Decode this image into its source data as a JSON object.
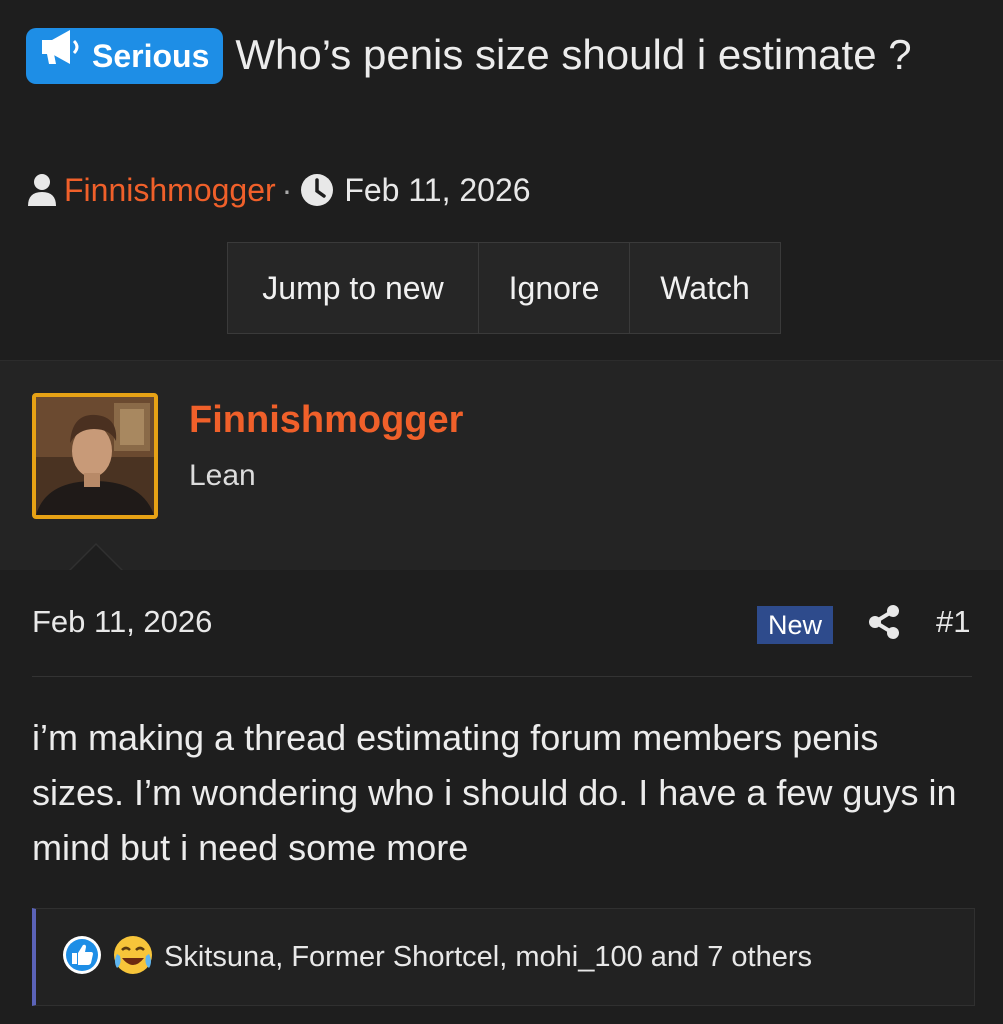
{
  "thread": {
    "prefix_label": "Serious",
    "title": "Who’s penis size should i estimate ?",
    "author": "Finnishmogger",
    "separator": "·",
    "date": "Feb 11, 2026"
  },
  "actions": {
    "jump_label": "Jump to new",
    "ignore_label": "Ignore",
    "watch_label": "Watch"
  },
  "post": {
    "username": "Finnishmogger",
    "user_title": "Lean",
    "date": "Feb 11, 2026",
    "new_badge": "New",
    "post_number": "#1",
    "content": "i’m making a thread estimating forum members penis sizes. I’m wondering who i should do. I have a few guys in mind but i need some more",
    "reactions_text": "Skitsuna, Former Shortcel, mohi_100 and 7 others"
  },
  "colors": {
    "background": "#1e1e1e",
    "prefix_blue": "#1e8ee6",
    "username_orange": "#f0602a",
    "new_badge": "#2e4b8c",
    "avatar_border": "#e7a215",
    "reaction_bar": "#5b63b8"
  },
  "icons": {
    "prefix": "megaphone-icon",
    "meta_author": "user-icon",
    "meta_date": "clock-icon",
    "share": "share-icon",
    "reaction_1": "like-icon",
    "reaction_2": "laugh-icon"
  }
}
